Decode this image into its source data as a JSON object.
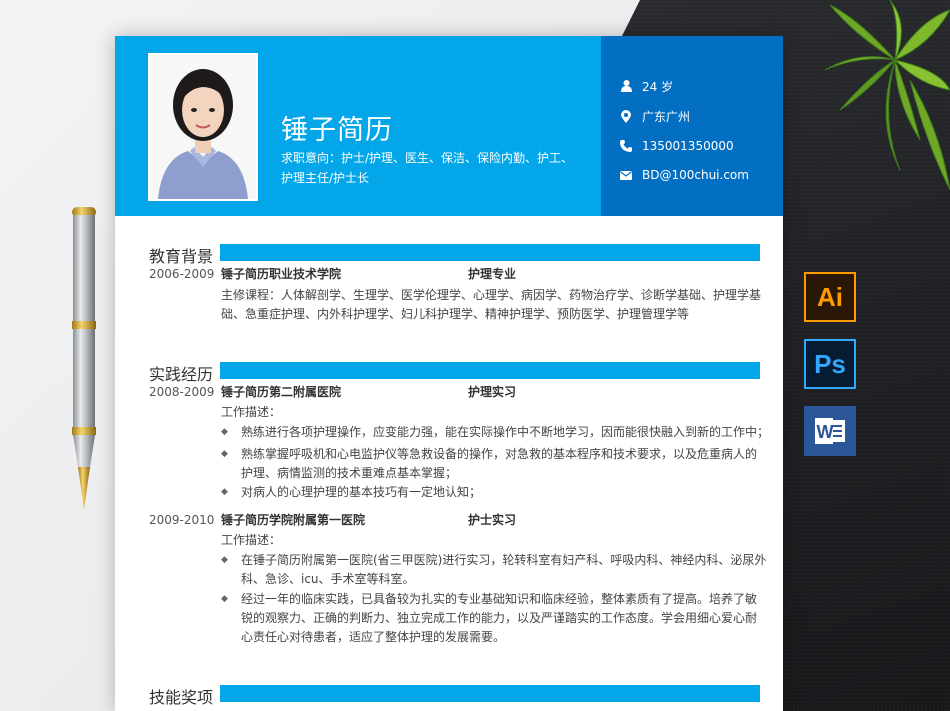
{
  "resume": {
    "name": "锤子简历",
    "intent_line1": "求职意向：护士/护理、医生、保洁、保险内勤、护工、",
    "intent_line2": "护理主任/护士长",
    "age": "24 岁",
    "location": "广东广州",
    "phone": "135001350000",
    "email": "BD@100chui.com"
  },
  "education": {
    "title": "教育背景",
    "date": "2006-2009",
    "school": "锤子简历职业技术学院",
    "major": "护理专业",
    "courses_line1": "主修课程：人体解剖学、生理学、医学伦理学、心理学、病因学、药物治疗学、诊断学基础、护理学基",
    "courses_line2": "础、急重症护理、内外科护理学、妇儿科护理学、精神护理学、预防医学、护理管理学等"
  },
  "practice": {
    "title": "实践经历",
    "jobs": [
      {
        "date": "2008-2009",
        "org": "锤子简历第二附属医院",
        "role": "护理实习",
        "desc_label": "工作描述：",
        "b1_l1": "熟练进行各项护理操作，应变能力强，能在实际操作中不断地学习，因而能很快融入到新的工作中；",
        "b2_l1": "熟练掌握呼吸机和心电监护仪等急救设备的操作，对急救的基本程序和技术要求，以及危重病人的",
        "b2_l2": "护理、病情监测的技术重难点基本掌握；",
        "b3_l1": "对病人的心理护理的基本技巧有一定地认知；"
      },
      {
        "date": "2009-2010",
        "org": "锤子简历学院附属第一医院",
        "role": "护士实习",
        "desc_label": "工作描述：",
        "b1_l1": "在锤子简历附属第一医院(省三甲医院)进行实习，轮转科室有妇产科、呼吸内科、神经内科、泌尿外",
        "b1_l2": "科、急诊、icu、手术室等科室。",
        "b2_l1": "经过一年的临床实践，已具备较为扎实的专业基础知识和临床经验，整体素质有了提高。培养了敏",
        "b2_l2": "锐的观察力、正确的判断力、独立完成工作的能力，以及严谨踏实的工作态度。学会用细心爱心耐",
        "b2_l3": "心责任心对待患者，适应了整体护理的发展需要。"
      }
    ]
  },
  "skills": {
    "title": "技能奖项"
  },
  "apps": {
    "ai": "Ai",
    "ps": "Ps",
    "word": "W"
  },
  "colors": {
    "accent": "#03a7e9",
    "accent_dark": "#036fc2"
  },
  "icons": [
    "user-icon",
    "location-pin-icon",
    "phone-icon",
    "mail-icon",
    "diamond-bullet-icon"
  ]
}
